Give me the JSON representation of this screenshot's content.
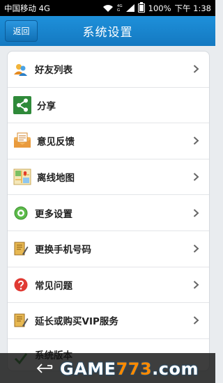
{
  "status": {
    "carrier": "中国移动 4G",
    "network_tag_top": "4G",
    "network_tag_bottom": "G",
    "battery": "100%",
    "time": "下午 1:38"
  },
  "header": {
    "back_label": "返回",
    "title": "系统设置"
  },
  "menu": {
    "items": [
      {
        "label": "好友列表",
        "icon": "friends-icon"
      },
      {
        "label": "分享",
        "icon": "share-icon"
      },
      {
        "label": "意见反馈",
        "icon": "feedback-envelope-icon"
      },
      {
        "label": "离线地图",
        "icon": "map-icon"
      },
      {
        "label": "更多设置",
        "icon": "gear-icon"
      },
      {
        "label": "更换手机号码",
        "icon": "notebook-pen-icon"
      },
      {
        "label": "常见问题",
        "icon": "question-icon"
      },
      {
        "label": "延长或购买VIP服务",
        "icon": "notebook-pen-icon"
      },
      {
        "label": "系统版本",
        "icon": "check-icon"
      }
    ]
  },
  "watermark": {
    "part1": "GAME",
    "part2": "773",
    "part3": ".com"
  },
  "colors": {
    "title_bar": "#1a86d0",
    "status_bar": "#000000",
    "background": "#e9ecef"
  }
}
